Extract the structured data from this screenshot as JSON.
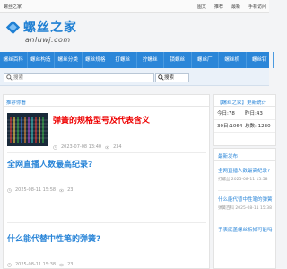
{
  "topbar": {
    "site_name": "螺丝之家",
    "links": [
      "图文",
      "推荐",
      "最新",
      "手机访问"
    ]
  },
  "logo": {
    "name": "螺丝之家",
    "domain": "anluwj.com"
  },
  "nav": [
    "螺丝百科",
    "螺丝构造",
    "螺丝分类",
    "螺丝规格",
    "打螺丝",
    "拧螺丝",
    "锁螺丝",
    "螺丝厂",
    "螺丝机",
    "螺丝钉"
  ],
  "search": {
    "placeholder": "搜索",
    "button_label": "搜索"
  },
  "main": {
    "heading": "推荐你看",
    "featured": {
      "title": "弹簧的规格型号及代表含义",
      "date": "2023-07-08 13:40",
      "views": "234"
    },
    "articles": [
      {
        "title": "全网直播人数最高纪录?",
        "date": "2025-08-11 15:58",
        "views": "23"
      },
      {
        "title": "什么能代替中性笔的弹簧?",
        "date": "2025-08-11 15:38",
        "views": "23"
      }
    ]
  },
  "stats_panel": {
    "heading": "【螺丝之家】更新统计",
    "rows": [
      [
        "今日:78",
        "昨日:43"
      ],
      [
        "30日:1064",
        "总数: 1230"
      ]
    ]
  },
  "latest_panel": {
    "heading": "最新发布",
    "items": [
      {
        "title": "全网直播人数最高纪录?",
        "meta": "打螺丝 2025-08-11 15:58"
      },
      {
        "title": "什么能代替中性笔的弹簧",
        "meta": "弹簧百科 2025-08-11 15:38"
      },
      {
        "title": "手表底盖螺丝拆掉可能吗",
        "meta": ""
      }
    ]
  },
  "colors": {
    "brand": "#2b86d8",
    "featured_title": "#e00000",
    "meta_text": "#999999"
  }
}
